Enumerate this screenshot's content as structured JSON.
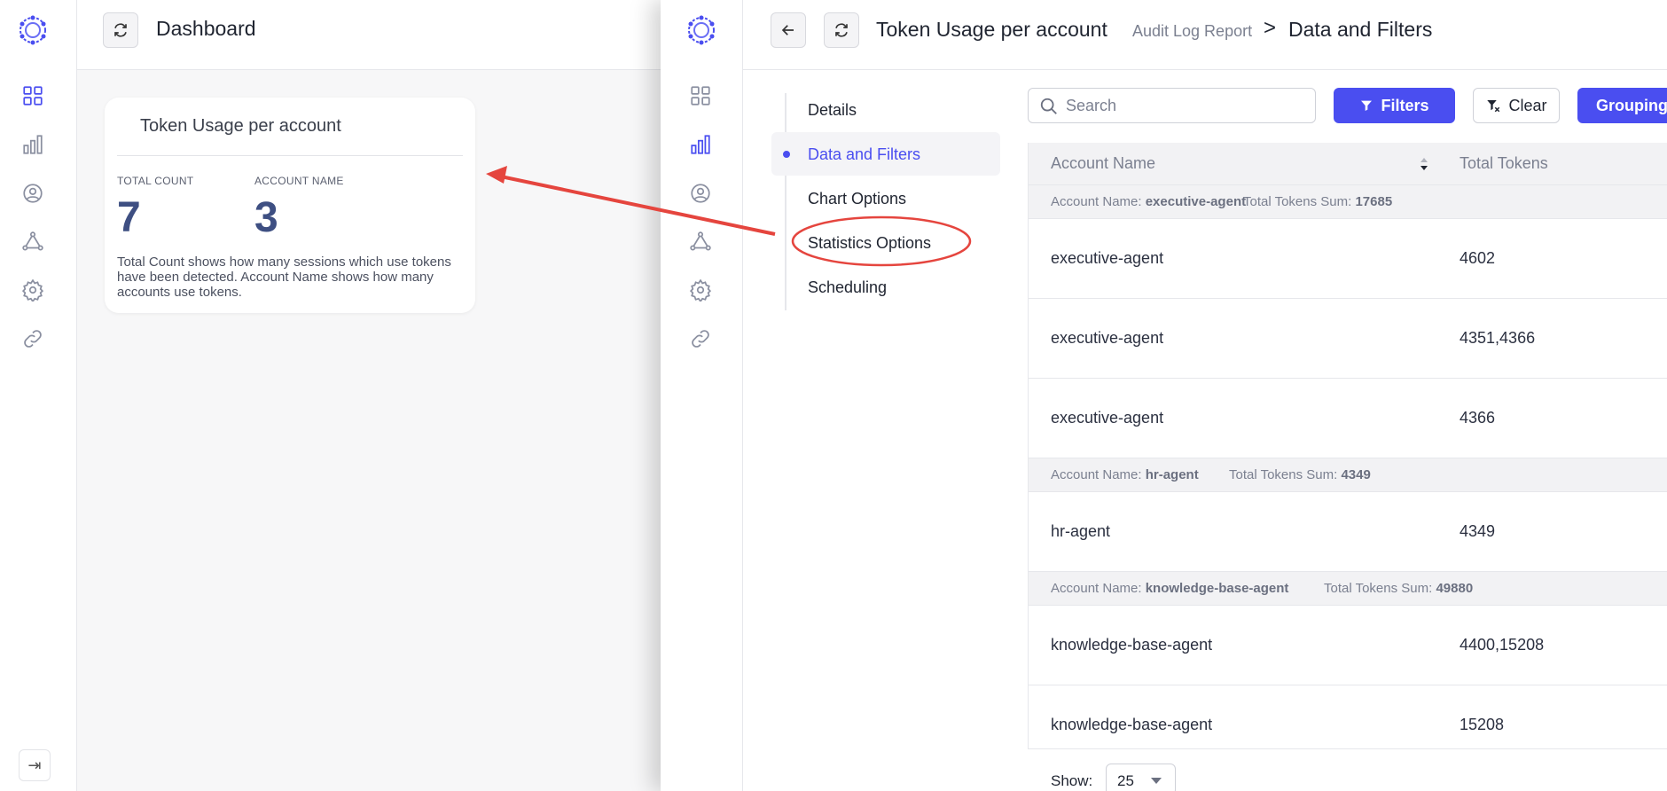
{
  "dashboard": {
    "title": "Dashboard",
    "widget": {
      "title": "Token Usage per account",
      "stats": [
        {
          "label": "TOTAL COUNT",
          "value": "7"
        },
        {
          "label": "ACCOUNT NAME",
          "value": "3"
        }
      ],
      "description": "Total Count shows how many sessions which use tokens have been detected. Account Name shows how many accounts use tokens."
    }
  },
  "sidebar_icons": [
    "grid-icon",
    "bar-chart-icon",
    "user-circle-icon",
    "network-icon",
    "gear-icon",
    "link-icon"
  ],
  "report": {
    "title": "Token Usage per account",
    "subtitle": "Audit Log Report",
    "separator": ">",
    "current": "Data and Filters",
    "sub_nav": [
      {
        "label": "Details",
        "active": false
      },
      {
        "label": "Data and Filters",
        "active": true
      },
      {
        "label": "Chart Options",
        "active": false
      },
      {
        "label": "Statistics Options",
        "active": false
      },
      {
        "label": "Scheduling",
        "active": false
      }
    ],
    "search_placeholder": "Search",
    "filters_label": "Filters",
    "clear_label": "Clear",
    "grouping_label": "Grouping",
    "columns": [
      "Account Name",
      "Total Tokens"
    ],
    "group_prefix_name": "Account Name:",
    "group_prefix_sum": "Total Tokens Sum:",
    "groups": [
      {
        "name": "executive-agent",
        "sum": "17685",
        "rows": [
          [
            "executive-agent",
            "4602"
          ],
          [
            "executive-agent",
            "4351,4366"
          ],
          [
            "executive-agent",
            "4366"
          ]
        ]
      },
      {
        "name": "hr-agent",
        "sum": "4349",
        "rows": [
          [
            "hr-agent",
            "4349"
          ]
        ]
      },
      {
        "name": "knowledge-base-agent",
        "sum": "49880",
        "rows": [
          [
            "knowledge-base-agent",
            "4400,15208"
          ],
          [
            "knowledge-base-agent",
            "15208"
          ]
        ]
      }
    ],
    "pager_label": "Show:",
    "page_size": "25"
  },
  "colors": {
    "accent": "#4a4ef0",
    "annotation": "#e5453e",
    "stat_value": "#3e4f82"
  }
}
